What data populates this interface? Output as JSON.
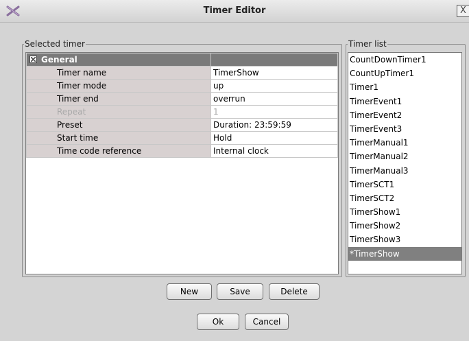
{
  "window": {
    "title": "Timer Editor",
    "close_label": "X"
  },
  "selected_timer": {
    "legend": "Selected timer",
    "section": "General",
    "rows": [
      {
        "name": "Timer name",
        "value": "TimerShow"
      },
      {
        "name": "Timer mode",
        "value": "up"
      },
      {
        "name": "Timer end",
        "value": "overrun"
      },
      {
        "name": "Repeat",
        "value": "1"
      },
      {
        "name": "Preset",
        "value": "Duration: 23:59:59"
      },
      {
        "name": "Start time",
        "value": "Hold"
      },
      {
        "name": "Time code reference",
        "value": "Internal clock"
      }
    ]
  },
  "timer_list": {
    "legend": "Timer list",
    "items": [
      "CountDownTimer1",
      "CountUpTimer1",
      "Timer1",
      "TimerEvent1",
      "TimerEvent2",
      "TimerEvent3",
      "TimerManual1",
      "TimerManual2",
      "TimerManual3",
      "TimerSCT1",
      "TimerSCT2",
      "TimerShow1",
      "TimerShow2",
      "TimerShow3",
      "*TimerShow"
    ],
    "selected_item": "*TimerShow"
  },
  "buttons": {
    "new": "New",
    "save": "Save",
    "delete": "Delete",
    "ok": "Ok",
    "cancel": "Cancel"
  }
}
